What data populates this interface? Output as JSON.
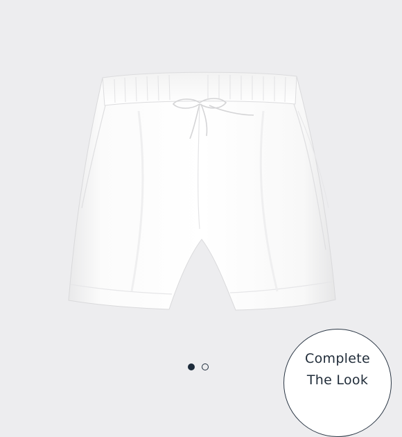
{
  "product": {
    "image_subject": "White pull-on shorts with drawstring waist",
    "image_alt": "White shorts"
  },
  "carousel": {
    "dots": [
      {
        "state": "active"
      },
      {
        "state": "inactive"
      }
    ]
  },
  "complete_the_look": {
    "line1": "Complete",
    "line2": "The Look"
  },
  "colors": {
    "background": "#ededef",
    "accent": "#1d2b3a",
    "garment": "#fbfbfb"
  }
}
